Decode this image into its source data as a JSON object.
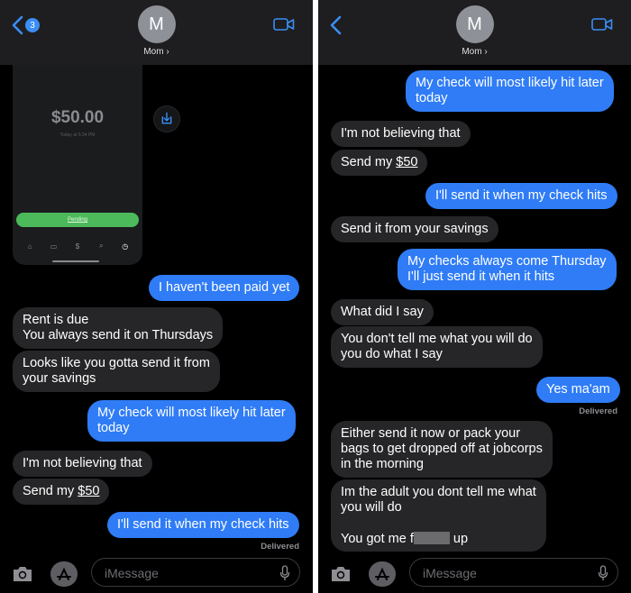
{
  "left": {
    "header": {
      "back_badge": "3",
      "avatar_initial": "M",
      "contact_name": "Mom ›"
    },
    "payment_card": {
      "amount": "$50.00",
      "timestamp": "Today at 5:34 PM",
      "status": "Pending"
    },
    "messages": [
      {
        "dir": "out",
        "text": "I haven't been paid yet"
      },
      {
        "dir": "in",
        "text": "Rent is due\nYou always send it on Thursdays"
      },
      {
        "dir": "in",
        "text": "Looks like you gotta send it from\nyour savings"
      },
      {
        "dir": "out",
        "text": "My check will most likely hit later\ntoday"
      },
      {
        "dir": "in",
        "text": "I'm not believing that"
      },
      {
        "dir": "in",
        "text_prefix": "Send my ",
        "text_link": "$50"
      },
      {
        "dir": "out",
        "text": "I'll send it when my check hits"
      }
    ],
    "delivered": "Delivered",
    "input_placeholder": "iMessage"
  },
  "right": {
    "header": {
      "avatar_initial": "M",
      "contact_name": "Mom ›"
    },
    "messages": [
      {
        "dir": "out",
        "text": "My check will most likely hit later\ntoday"
      },
      {
        "dir": "in",
        "text": "I'm not believing that"
      },
      {
        "dir": "in",
        "text_prefix": "Send my ",
        "text_link": "$50"
      },
      {
        "dir": "out",
        "text": "I'll send it when my check hits"
      },
      {
        "dir": "in",
        "text": "Send it from your savings"
      },
      {
        "dir": "out",
        "text": "My checks always come Thursday\nI'll just send it when it hits"
      },
      {
        "dir": "in",
        "text": "What did I say"
      },
      {
        "dir": "in",
        "text": "You don't tell me what you will do\nyou do what I say"
      },
      {
        "dir": "out",
        "text": "Yes ma'am"
      },
      {
        "dir": "in",
        "text": "Either send it now or pack your\nbags to get dropped off at jobcorps\nin the morning"
      },
      {
        "dir": "in",
        "text": "Im the adult you dont tell me what\nyou will do",
        "text_suffix_prefix": "You got me f",
        "text_suffix_end": " up"
      }
    ],
    "delivered": "Delivered",
    "input_placeholder": "iMessage"
  },
  "colors": {
    "outgoing": "#2f7cf6",
    "incoming": "#262628",
    "header": "#1e1e20",
    "background": "#000000",
    "pending": "#4cba5a"
  },
  "icons": [
    "chevron-left-icon",
    "video-camera-icon",
    "download-icon",
    "camera-icon",
    "app-store-icon",
    "microphone-icon"
  ]
}
